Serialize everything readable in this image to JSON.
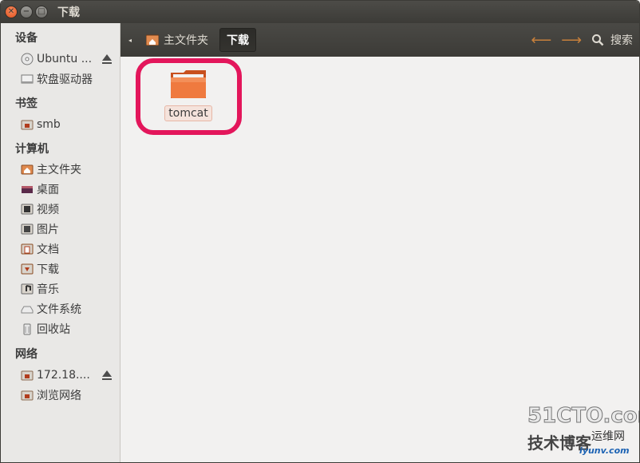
{
  "window": {
    "title": "下载"
  },
  "toolbar": {
    "breadcrumbs": [
      {
        "label": "主文件夹"
      },
      {
        "label": "下载"
      }
    ],
    "search_label": "搜索"
  },
  "sidebar": {
    "sections": [
      {
        "heading": "设备",
        "items": [
          {
            "label": "Ubuntu ...",
            "icon": "disc-icon"
          },
          {
            "label": "软盘驱动器",
            "icon": "floppy-icon"
          }
        ]
      },
      {
        "heading": "书签",
        "items": [
          {
            "label": "smb",
            "icon": "folder-icon"
          }
        ]
      },
      {
        "heading": "计算机",
        "items": [
          {
            "label": "主文件夹",
            "icon": "home-folder-icon"
          },
          {
            "label": "桌面",
            "icon": "desktop-icon"
          },
          {
            "label": "视频",
            "icon": "video-folder-icon"
          },
          {
            "label": "图片",
            "icon": "pictures-folder-icon"
          },
          {
            "label": "文档",
            "icon": "documents-folder-icon"
          },
          {
            "label": "下载",
            "icon": "downloads-folder-icon"
          },
          {
            "label": "音乐",
            "icon": "music-folder-icon"
          },
          {
            "label": "文件系统",
            "icon": "drive-icon"
          },
          {
            "label": "回收站",
            "icon": "trash-icon"
          }
        ]
      },
      {
        "heading": "网络",
        "items": [
          {
            "label": "172.18....",
            "icon": "network-folder-icon"
          },
          {
            "label": "浏览网络",
            "icon": "network-folder-icon"
          }
        ]
      }
    ]
  },
  "main": {
    "files": [
      {
        "name": "tomcat",
        "type": "folder"
      }
    ]
  },
  "watermark": {
    "line1": "51CTO.com",
    "line2": "技术博客",
    "line3": "运维网",
    "url": "iyunv.com"
  },
  "colors": {
    "accent": "#e3165b",
    "folder": "#e8692f",
    "titlebar": "#3c3b37"
  }
}
